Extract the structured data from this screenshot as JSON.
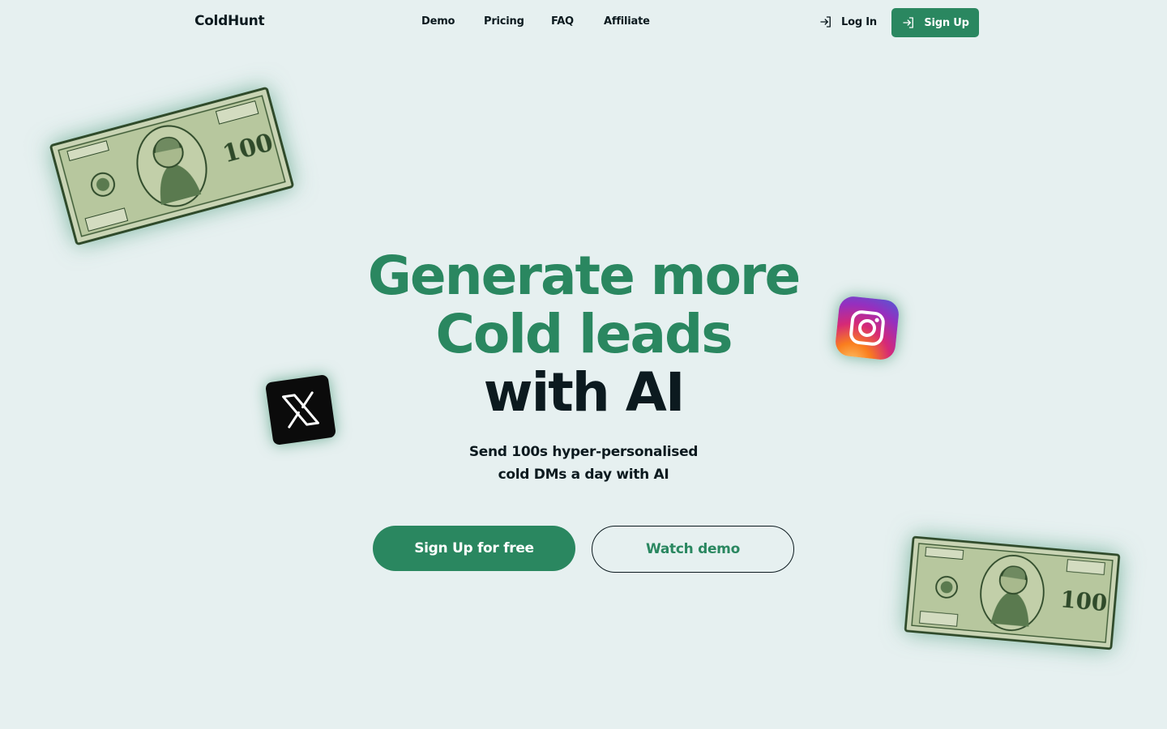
{
  "nav": {
    "logo": "ColdHunt",
    "links": [
      "Demo",
      "Pricing",
      "FAQ",
      "Affiliate"
    ],
    "login_label": "Log In",
    "signup_label": "Sign Up"
  },
  "hero": {
    "title_line1": "Generate more",
    "title_line2": "Cold leads",
    "title_line3": "with AI",
    "subtitle_line1": "Send 100s hyper-personalised",
    "subtitle_line2": "cold DMs a day with AI",
    "primary_cta": "Sign Up for free",
    "secondary_cta": "Watch demo"
  },
  "decorations": {
    "bill_text_1": "100",
    "icons": [
      "hundred-dollar-bill",
      "x-logo",
      "instagram-logo"
    ]
  },
  "colors": {
    "accent": "#2a8760",
    "background": "#e6f0f0",
    "text": "#0c1a1f"
  }
}
